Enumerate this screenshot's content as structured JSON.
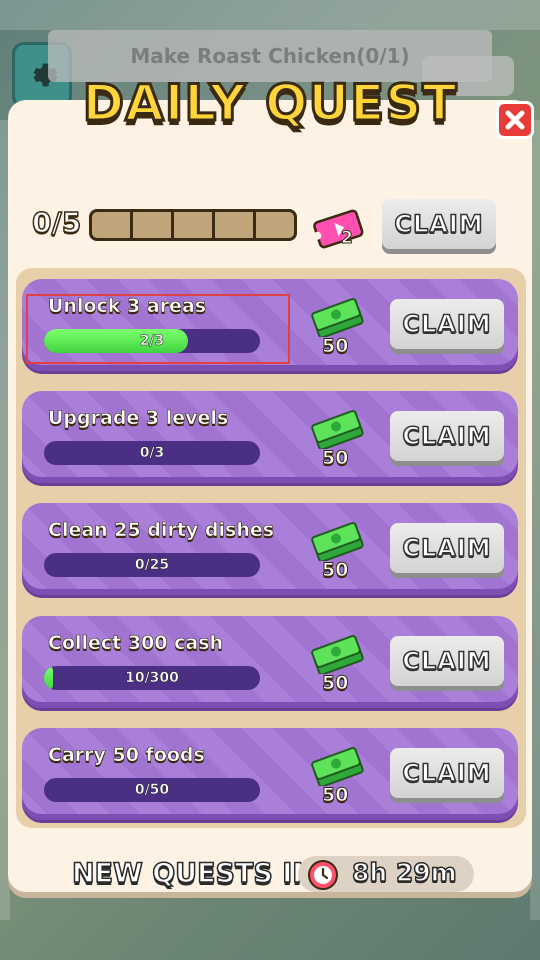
{
  "background": {
    "task_label": "Make Roast Chicken(0/1)"
  },
  "modal": {
    "title": "DAILY QUEST",
    "overall": {
      "label": "0/5",
      "completed": 0,
      "segments": 5,
      "ticket_reward": "2",
      "claim_label": "CLAIM"
    },
    "quests": [
      {
        "title": "Unlock 3 areas",
        "progress_text": "2/3",
        "progress": 0.6667,
        "reward": "50",
        "claim_label": "CLAIM"
      },
      {
        "title": "Upgrade 3 levels",
        "progress_text": "0/3",
        "progress": 0,
        "reward": "50",
        "claim_label": "CLAIM"
      },
      {
        "title": "Clean 25 dirty dishes",
        "progress_text": "0/25",
        "progress": 0,
        "reward": "50",
        "claim_label": "CLAIM"
      },
      {
        "title": "Collect 300 cash",
        "progress_text": "10/300",
        "progress": 0.0333,
        "reward": "50",
        "claim_label": "CLAIM"
      },
      {
        "title": "Carry 50 foods",
        "progress_text": "0/50",
        "progress": 0,
        "reward": "50",
        "claim_label": "CLAIM"
      }
    ],
    "footer": {
      "new_quests_label": "NEW QUESTS IN:",
      "timer": "8h 29m"
    }
  },
  "icons": {
    "settings": "gear-icon",
    "close": "close-icon",
    "ticket": "ticket-icon",
    "cash": "cash-stack-icon",
    "timer": "clock-icon"
  },
  "colors": {
    "title_fill": "#ffd53a",
    "quest_card": "#a678d8",
    "progress_fill": "#3fd43f",
    "close_button": "#ea3b3b"
  }
}
